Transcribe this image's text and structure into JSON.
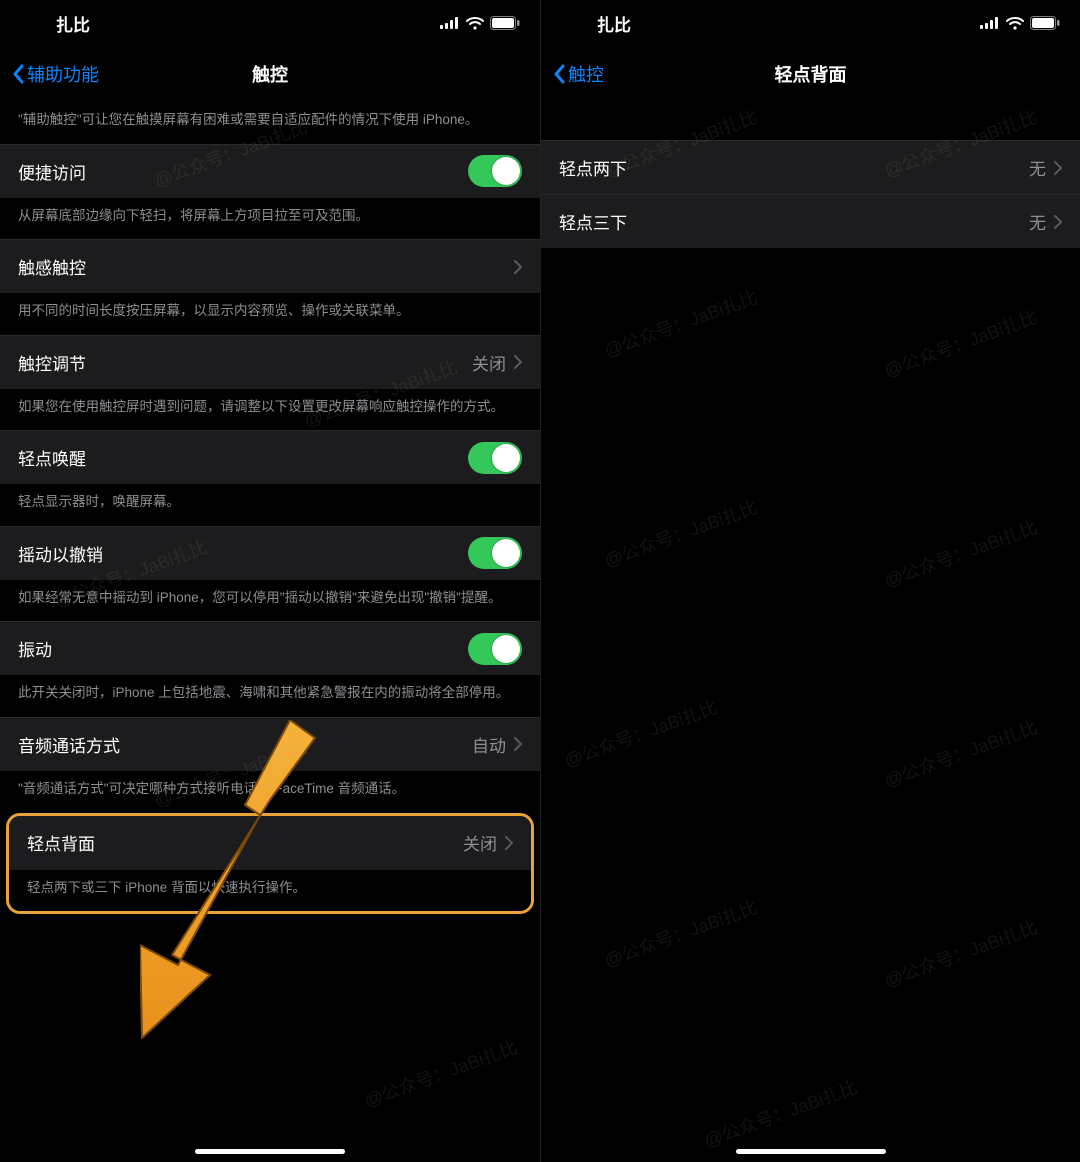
{
  "status": {
    "carrier": "扎比"
  },
  "watermark": "@公众号：JaBi扎比",
  "left": {
    "nav": {
      "back": "辅助功能",
      "title": "触控"
    },
    "sections": {
      "assistive_footer": "\"辅助触控\"可让您在触摸屏幕有困难或需要自适应配件的情况下使用 iPhone。",
      "reachability": {
        "label": "便捷访问",
        "footer": "从屏幕底部边缘向下轻扫，将屏幕上方项目拉至可及范围。"
      },
      "haptic": {
        "label": "触感触控",
        "footer": "用不同的时间长度按压屏幕，以显示内容预览、操作或关联菜单。"
      },
      "accommodations": {
        "label": "触控调节",
        "value": "关闭",
        "footer": "如果您在使用触控屏时遇到问题，请调整以下设置更改屏幕响应触控操作的方式。"
      },
      "tap_wake": {
        "label": "轻点唤醒",
        "footer": "轻点显示器时，唤醒屏幕。"
      },
      "shake": {
        "label": "摇动以撤销",
        "footer": "如果经常无意中摇动到 iPhone，您可以停用\"摇动以撤销\"来避免出现\"撤销\"提醒。"
      },
      "vibration": {
        "label": "振动",
        "footer": "此开关关闭时，iPhone 上包括地震、海啸和其他紧急警报在内的振动将全部停用。"
      },
      "call_audio": {
        "label": "音频通话方式",
        "value": "自动",
        "footer": "\"音频通话方式\"可决定哪种方式接听电话或 FaceTime 音频通话。"
      },
      "back_tap": {
        "label": "轻点背面",
        "value": "关闭",
        "footer": "轻点两下或三下 iPhone 背面以快速执行操作。"
      }
    }
  },
  "right": {
    "nav": {
      "back": "触控",
      "title": "轻点背面"
    },
    "rows": [
      {
        "label": "轻点两下",
        "value": "无"
      },
      {
        "label": "轻点三下",
        "value": "无"
      }
    ]
  }
}
